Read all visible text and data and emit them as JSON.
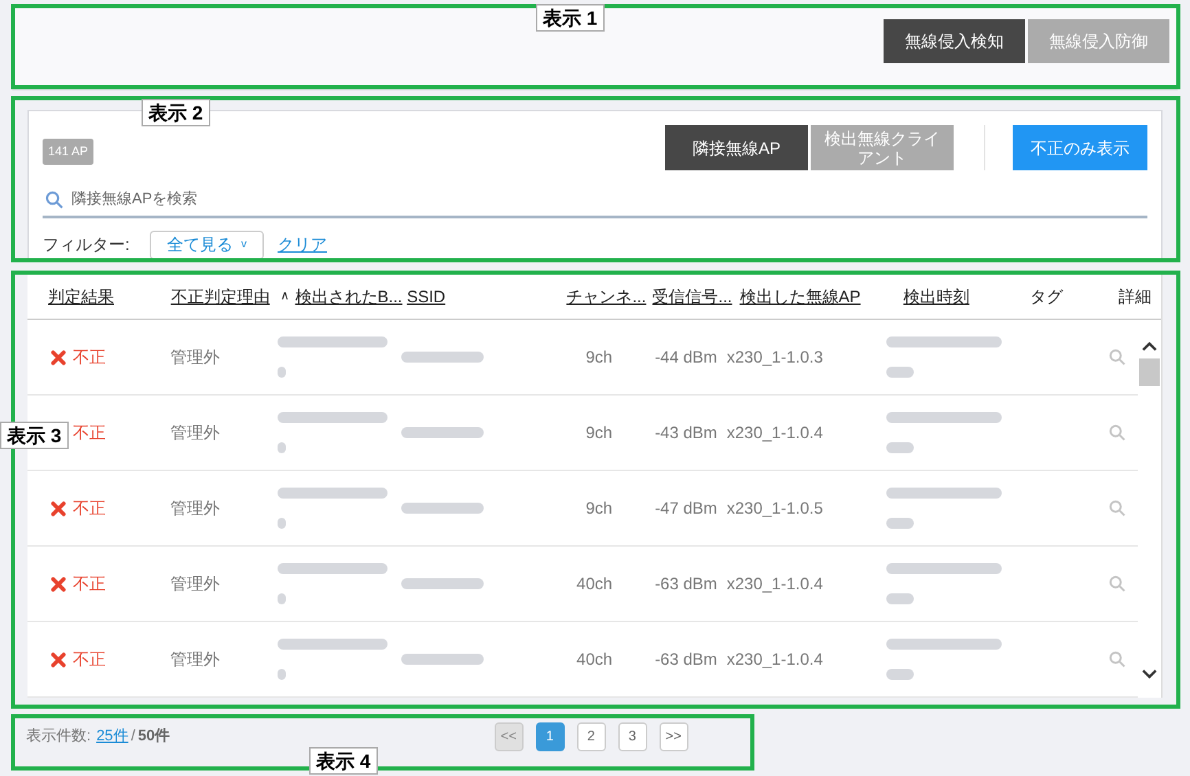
{
  "mode_tabs": [
    {
      "label": "無線侵入検知",
      "selected": true
    },
    {
      "label": "無線侵入防御",
      "selected": false
    }
  ],
  "ap_count": "141 AP",
  "view_tabs": [
    {
      "label": "隣接無線AP",
      "selected": true
    },
    {
      "label": "検出無線クライアント",
      "selected": false
    }
  ],
  "rogue_only_button": "不正のみ表示",
  "search": {
    "placeholder": "隣接無線APを検索"
  },
  "filter": {
    "label": "フィルター:",
    "value": "全て見る",
    "caret": "v",
    "clear": "クリア"
  },
  "table": {
    "columns": [
      {
        "label": "判定結果",
        "sortable": true
      },
      {
        "label": "不正判定理由",
        "sortable": true
      },
      {
        "label": "検出されたB...",
        "sortable": true,
        "sort_indicator": "∧"
      },
      {
        "label": "SSID",
        "sortable": true
      },
      {
        "label": "チャンネ...",
        "sortable": true
      },
      {
        "label": "受信信号...",
        "sortable": true
      },
      {
        "label": "検出した無線AP",
        "sortable": true
      },
      {
        "label": "検出時刻",
        "sortable": true
      },
      {
        "label": "タグ",
        "sortable": false
      },
      {
        "label": "詳細",
        "sortable": false
      }
    ],
    "rows": [
      {
        "result": "不正",
        "rogue": true,
        "reason": "管理外",
        "bssid_blurred": true,
        "ssid_blurred": true,
        "channel": "9ch",
        "signal": "-44 dBm",
        "ap": "x230_1-1.0.3",
        "time_blurred": true
      },
      {
        "result": "不正",
        "rogue": true,
        "reason": "管理外",
        "bssid_blurred": true,
        "ssid_blurred": true,
        "channel": "9ch",
        "signal": "-43 dBm",
        "ap": "x230_1-1.0.4",
        "time_blurred": true
      },
      {
        "result": "不正",
        "rogue": true,
        "reason": "管理外",
        "bssid_blurred": true,
        "ssid_blurred": true,
        "channel": "9ch",
        "signal": "-47 dBm",
        "ap": "x230_1-1.0.5",
        "time_blurred": true
      },
      {
        "result": "不正",
        "rogue": true,
        "reason": "管理外",
        "bssid_blurred": true,
        "ssid_blurred": true,
        "channel": "40ch",
        "signal": "-63 dBm",
        "ap": "x230_1-1.0.4",
        "time_blurred": true
      },
      {
        "result": "不正",
        "rogue": true,
        "reason": "管理外",
        "bssid_blurred": true,
        "ssid_blurred": true,
        "channel": "40ch",
        "signal": "-63 dBm",
        "ap": "x230_1-1.0.4",
        "time_blurred": true
      }
    ]
  },
  "footer": {
    "label": "表示件数:",
    "page_size": "25件",
    "separator": "/",
    "total": "50件"
  },
  "pagination": [
    {
      "label": "<<",
      "kind": "nav",
      "disabled": true
    },
    {
      "label": "1",
      "kind": "page",
      "selected": true
    },
    {
      "label": "2",
      "kind": "page",
      "selected": false
    },
    {
      "label": "3",
      "kind": "page",
      "selected": false
    },
    {
      "label": ">>",
      "kind": "nav",
      "disabled": false
    }
  ],
  "annotations": [
    {
      "label": "表示 1"
    },
    {
      "label": "表示 2"
    },
    {
      "label": "表示 3"
    },
    {
      "label": "表示 4"
    }
  ]
}
